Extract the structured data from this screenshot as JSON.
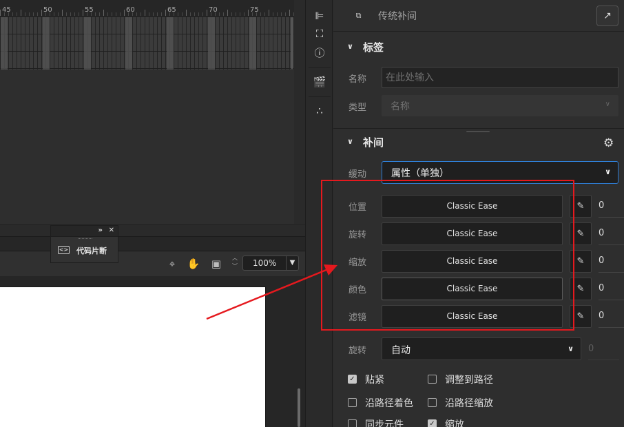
{
  "timeline": {
    "ruler_labels": [
      "45",
      "50",
      "55",
      "60",
      "65",
      "70",
      "75"
    ],
    "zoom": "100%"
  },
  "code_snippets_panel": {
    "label": "代码片断"
  },
  "properties": {
    "title": "传统补间",
    "label_section": {
      "title": "标签",
      "name_label": "名称",
      "name_placeholder": "在此处输入",
      "type_label": "类型",
      "type_value": "名称"
    },
    "tween_section": {
      "title": "补间",
      "ease_label": "缓动",
      "ease_value": "属性（单独）",
      "ease_rows": [
        {
          "label": "位置",
          "ease": "Classic Ease",
          "value": "0"
        },
        {
          "label": "旋转",
          "ease": "Classic Ease",
          "value": "0"
        },
        {
          "label": "缩放",
          "ease": "Classic Ease",
          "value": "0"
        },
        {
          "label": "颜色",
          "ease": "Classic Ease",
          "value": "0"
        },
        {
          "label": "滤镜",
          "ease": "Classic Ease",
          "value": "0"
        }
      ],
      "rotate_label": "旋转",
      "rotate_value": "自动",
      "rotate_count": "0",
      "checkboxes": [
        {
          "label": "贴紧",
          "checked": true
        },
        {
          "label": "调整到路径",
          "checked": false
        },
        {
          "label": "沿路径着色",
          "checked": false
        },
        {
          "label": "沿路径缩放",
          "checked": false
        },
        {
          "label": "同步元件",
          "checked": false
        },
        {
          "label": "缩放",
          "checked": true
        }
      ]
    }
  },
  "colors": {
    "annotation": "#e5191e",
    "focus_border": "#2f7fd7",
    "panel_bg": "#2e2e2e"
  }
}
